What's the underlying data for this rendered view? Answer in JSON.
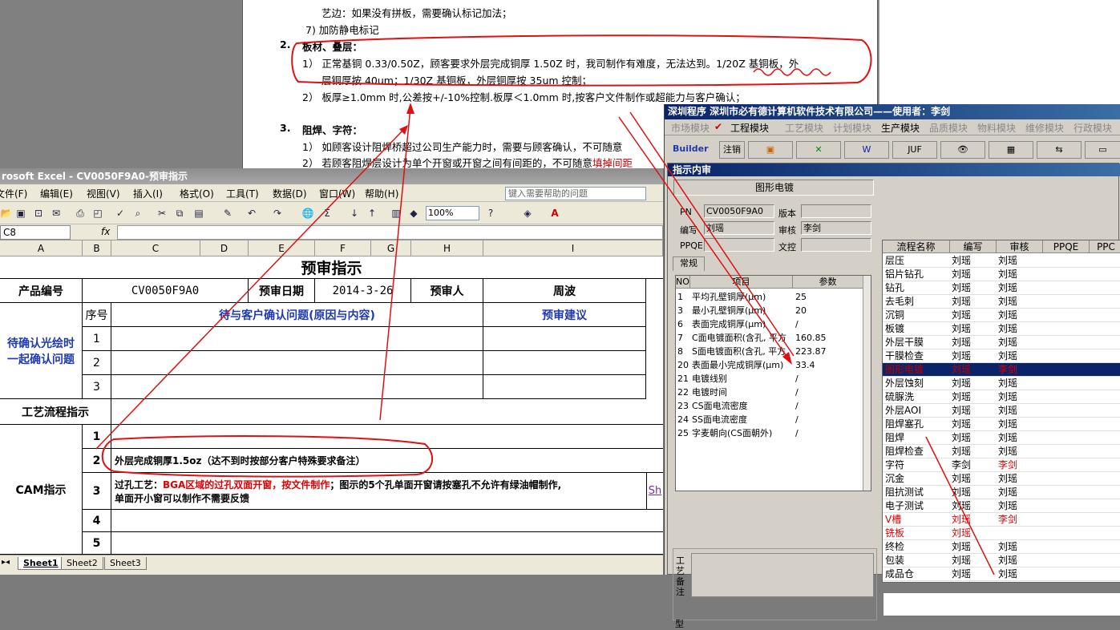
{
  "word": {
    "line_prefix": "艺边：如果没有拼板，需要确认标记加法；",
    "item7": "7) 加防静电标记",
    "sec2_num": "2.",
    "sec2_title": "板材、叠层：",
    "sec2_item1_a": "1） 正常基铜 0.33/0.50Z，顾客要求外层完成铜厚 1.50Z 时，我司制作有难度，无法达到。1/20Z 基铜板，外",
    "sec2_item1_b": "层铜厚按 40um；1/30Z 基铜板，外层铜厚按 35um 控制；",
    "sec2_item2": "2） 板厚≥1.0mm 时,公差按+/-10%控制.板厚＜1.0mm 时,按客户文件制作或超能力与客户确认；",
    "sec3_num": "3.",
    "sec3_title": "阻焊、字符：",
    "sec3_item1": "1） 如顾客设计阻焊桥超过公司生产能力时，需要与顾客确认，不可随意",
    "sec3_item2_a": "2） 若顾客阻焊层设计为单个开窗或开窗之间有间距的，不可随意",
    "sec3_item2_b": "填掉间距"
  },
  "excel": {
    "title": "rosoft Excel - CV0050F9A0-预审指示",
    "menu": [
      "文件(F)",
      "编辑(E)",
      "视图(V)",
      "插入(I)",
      "格式(O)",
      "工具(T)",
      "数据(D)",
      "窗口(W)",
      "帮助(H)"
    ],
    "help_placeholder": "键入需要帮助的问题",
    "zoom": "100%",
    "name_box": "C8",
    "fx": "fx",
    "columns": [
      "A",
      "B",
      "C",
      "D",
      "E",
      "F",
      "G",
      "H",
      "I"
    ],
    "sheet": {
      "title": "预审指示",
      "product_no_label": "产品编号",
      "product_no": "CV0050F9A0",
      "review_date_label": "预审日期",
      "review_date": "2014-3-26",
      "reviewer_label": "预审人",
      "reviewer": "周波",
      "seq_label": "序号",
      "issues_label": "待与客户确认问题(原因与内容)",
      "suggest_label": "预审建议",
      "side_label_1": "待确认光绘时",
      "side_label_2": "一起确认问题",
      "rows_a": [
        "1",
        "2",
        "3"
      ],
      "process_label": "工艺流程指示",
      "cam_label": "CAM指示",
      "rows_b": [
        "1",
        "2",
        "3",
        "4",
        "5"
      ],
      "cam_row2": "外层完成铜厚1.5oz（达不到时按部分客户特殊要求备注）",
      "cam_row3_prefix": "过孔工艺：",
      "cam_row3_red": "BGA区域的过孔双面开窗，按文件制作",
      "cam_row3_rest": "；图示的5个孔单面开窗请按塞孔不允许有绿油帽制作,",
      "cam_row3_line2": "单面开小窗可以制作不需要反馈",
      "overflow_text": "Sh"
    },
    "tabs": [
      "Sheet1",
      "Sheet2",
      "Sheet3"
    ]
  },
  "app": {
    "title": "深圳程序   深圳市必有德计算机软件技术有限公司——使用者：李剑",
    "modules": [
      "市场模块",
      "工程模块",
      "工艺模块",
      "计划模块",
      "生产模块",
      "品质模块",
      "物料模块",
      "维修模块",
      "行政模块"
    ],
    "toolbar": [
      "Builder",
      "注销",
      "JUF"
    ],
    "inner_title": "指示内审",
    "header_label": "图形电镀",
    "pn_label": "PN",
    "pn": "CV0050F9A0",
    "version_label": "版本",
    "author_label": "编写",
    "author": "刘瑶",
    "audit_label": "审核",
    "audit": "李剑",
    "ppqe_label": "PPQE",
    "doc_label": "文控",
    "tab_normal": "常规",
    "params_headers": [
      "NO",
      "项目",
      "参数"
    ],
    "params": [
      {
        "no": "1",
        "item": "平均孔壁铜厚(μm)",
        "val": "25"
      },
      {
        "no": "3",
        "item": "最小孔壁铜厚(μm)",
        "val": "20"
      },
      {
        "no": "6",
        "item": "表面完成铜厚(μm)",
        "val": "/"
      },
      {
        "no": "7",
        "item": "C面电镀面积(含孔, 平方",
        "val": "160.85"
      },
      {
        "no": "8",
        "item": "S面电镀面积(含孔, 平方",
        "val": "223.87"
      },
      {
        "no": "20",
        "item": "表面最小完成铜厚(μm)",
        "val": "33.4"
      },
      {
        "no": "21",
        "item": "电镀线别",
        "val": "/"
      },
      {
        "no": "22",
        "item": "电镀时间",
        "val": "/"
      },
      {
        "no": "23",
        "item": "CS面电流密度",
        "val": "/"
      },
      {
        "no": "24",
        "item": "SS面电流密度",
        "val": "/"
      },
      {
        "no": "25",
        "item": "字麦朝向(CS面朝外)",
        "val": "/"
      }
    ],
    "remark_label": "工艺备注",
    "model_label": "型",
    "flow_headers": [
      "流程名称",
      "编写",
      "审核",
      "PPQE",
      "PPC"
    ],
    "flow": [
      {
        "n": "层压",
        "w": "刘瑶",
        "a": "刘瑶"
      },
      {
        "n": "铝片钻孔",
        "w": "刘瑶",
        "a": "刘瑶"
      },
      {
        "n": "钻孔",
        "w": "刘瑶",
        "a": "刘瑶"
      },
      {
        "n": "去毛刺",
        "w": "刘瑶",
        "a": "刘瑶"
      },
      {
        "n": "沉铜",
        "w": "刘瑶",
        "a": "刘瑶"
      },
      {
        "n": "板镀",
        "w": "刘瑶",
        "a": "刘瑶"
      },
      {
        "n": "外层干膜",
        "w": "刘瑶",
        "a": "刘瑶"
      },
      {
        "n": "干膜检查",
        "w": "刘瑶",
        "a": "刘瑶"
      },
      {
        "n": "图形电镀",
        "w": "刘瑶",
        "a": "李剑"
      },
      {
        "n": "外层蚀刻",
        "w": "刘瑶",
        "a": "刘瑶"
      },
      {
        "n": "硫脲洗",
        "w": "刘瑶",
        "a": "刘瑶"
      },
      {
        "n": "外层AOI",
        "w": "刘瑶",
        "a": "刘瑶"
      },
      {
        "n": "阻焊塞孔",
        "w": "刘瑶",
        "a": "刘瑶"
      },
      {
        "n": "阻焊",
        "w": "刘瑶",
        "a": "刘瑶"
      },
      {
        "n": "阻焊检查",
        "w": "刘瑶",
        "a": "刘瑶"
      },
      {
        "n": "字符",
        "w": "李剑",
        "a": "李剑"
      },
      {
        "n": "沉金",
        "w": "刘瑶",
        "a": "刘瑶"
      },
      {
        "n": "阻抗测试",
        "w": "刘瑶",
        "a": "刘瑶"
      },
      {
        "n": "电子测试",
        "w": "刘瑶",
        "a": "刘瑶"
      },
      {
        "n": "V槽",
        "w": "刘瑶",
        "a": "李剑"
      },
      {
        "n": "铣板",
        "w": "刘瑶",
        "a": ""
      },
      {
        "n": "终检",
        "w": "刘瑶",
        "a": "刘瑶"
      },
      {
        "n": "包装",
        "w": "刘瑶",
        "a": "刘瑶"
      },
      {
        "n": "成品仓",
        "w": "刘瑶",
        "a": "刘瑶"
      }
    ]
  },
  "colors": {
    "annotation_red": "#e01010",
    "title_blue": "#0a246a",
    "label_blue": "#1f3ab0"
  }
}
